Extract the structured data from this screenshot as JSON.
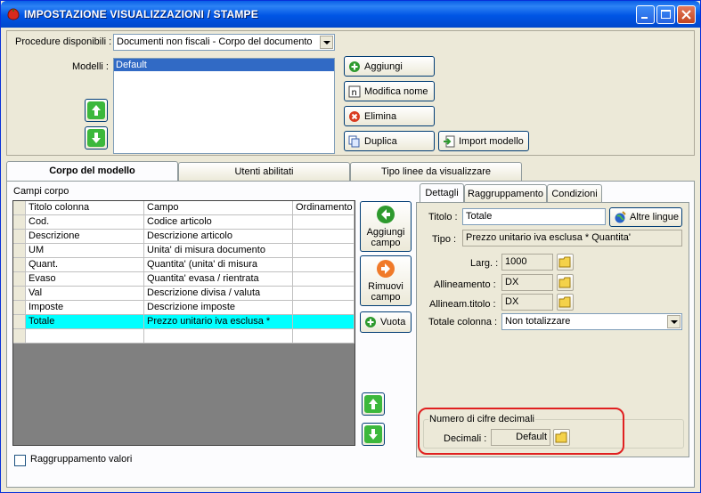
{
  "window": {
    "title": "IMPOSTAZIONE VISUALIZZAZIONI / STAMPE"
  },
  "top": {
    "procedure_label": "Procedure disponibili :",
    "procedure_value": "Documenti non fiscali - Corpo del documento",
    "modelli_label": "Modelli :",
    "modelli_items": [
      "Default"
    ],
    "buttons": {
      "aggiungi": "Aggiungi",
      "modifica_nome": "Modifica nome",
      "elimina": "Elimina",
      "duplica": "Duplica",
      "import_modello": "Import modello"
    }
  },
  "tabs": [
    "Corpo del modello",
    "Utenti abilitati",
    "Tipo linee da visualizzare"
  ],
  "corpo": {
    "section_label": "Campi corpo",
    "columns": [
      "Titolo colonna",
      "Campo",
      "Ordinamento"
    ],
    "rows": [
      [
        "Cod.",
        "Codice articolo",
        ""
      ],
      [
        "Descrizione",
        "Descrizione articolo",
        ""
      ],
      [
        "UM",
        "Unita' di misura documento",
        ""
      ],
      [
        "Quant.",
        "Quantita' (unita' di misura",
        ""
      ],
      [
        "Evaso",
        "Quantita' evasa / rientrata",
        ""
      ],
      [
        "Val",
        "Descrizione divisa / valuta",
        ""
      ],
      [
        "Imposte",
        "Descrizione imposte",
        ""
      ],
      [
        "Totale",
        "Prezzo unitario iva esclusa *",
        ""
      ],
      [
        "",
        "",
        ""
      ]
    ],
    "aggiungi_campo": "Aggiungi campo",
    "rimuovi_campo": "Rimuovi campo",
    "vuota": "Vuota",
    "raggruppamento": "Raggruppamento valori"
  },
  "details": {
    "tabs": [
      "Dettagli",
      "Raggruppamento",
      "Condizioni"
    ],
    "titolo_label": "Titolo :",
    "titolo_value": "Totale",
    "altre_lingue": "Altre lingue",
    "tipo_label": "Tipo :",
    "tipo_value": "Prezzo unitario iva esclusa * Quantita'",
    "larg_label": "Larg. :",
    "larg_value": "1000",
    "allineamento_label": "Allineamento :",
    "allineamento_value": "DX",
    "allineam_titolo_label": "Allineam.titolo :",
    "allineam_titolo_value": "DX",
    "totale_colonna_label": "Totale colonna :",
    "totale_colonna_value": "Non totalizzare",
    "decimali_group": "Numero di cifre decimali",
    "decimali_label": "Decimali :",
    "decimali_value": "Default"
  },
  "colors": {
    "accent": "#316ac5",
    "highlight_row": "#00ffff",
    "ring": "#e02020"
  }
}
